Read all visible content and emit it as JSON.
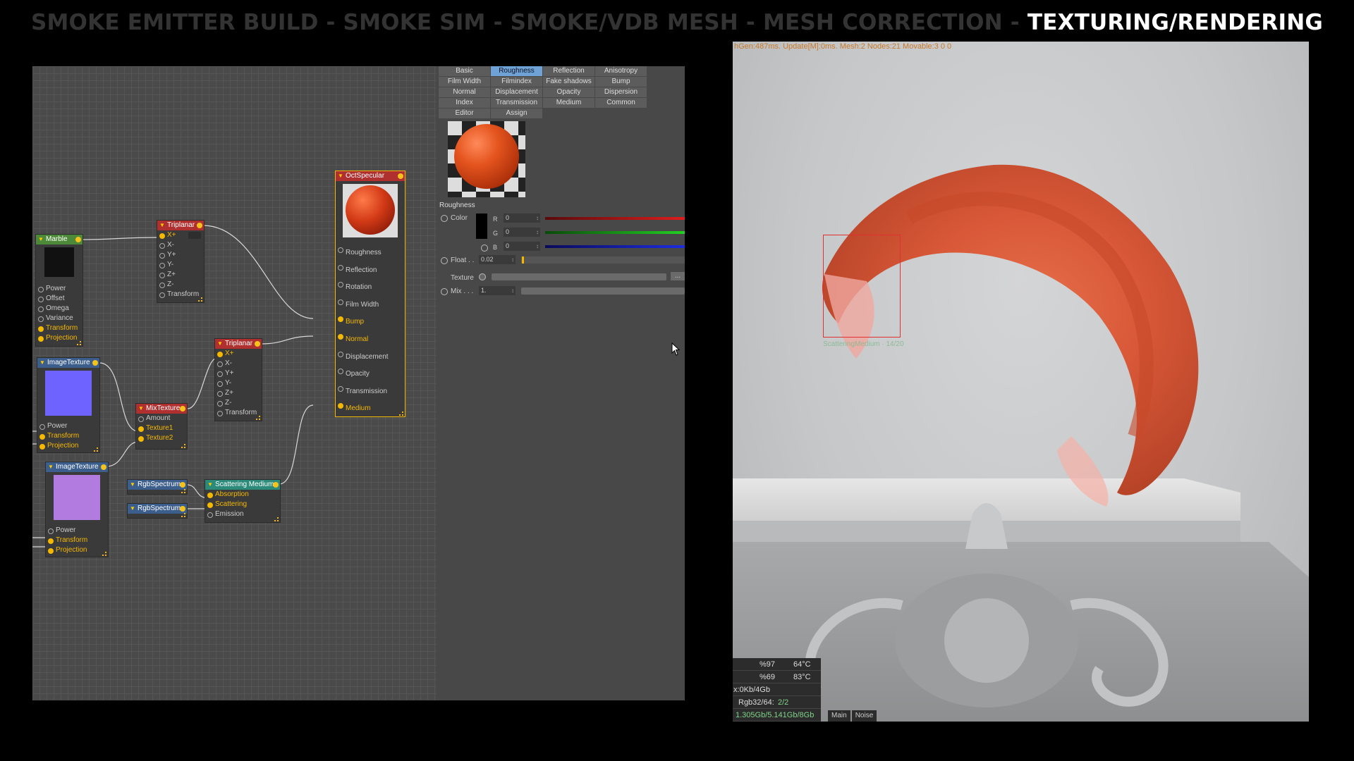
{
  "title": {
    "dim_text": "SMOKE EMITTER BUILD - SMOKE SIM - SMOKE/VDB MESH - MESH CORRECTION - ",
    "active_text": "TEXTURING/RENDERING"
  },
  "nodes": {
    "marble": {
      "title": "Marble",
      "pins": [
        "Power",
        "Offset",
        "Omega",
        "Variance",
        "Transform",
        "Projection"
      ]
    },
    "triplanar_1": {
      "title": "Triplanar",
      "pins": [
        "X+",
        "X-",
        "Y+",
        "Y-",
        "Z+",
        "Z-",
        "Transform"
      ]
    },
    "triplanar_2": {
      "title": "Triplanar",
      "pins": [
        "X+",
        "X-",
        "Y+",
        "Y-",
        "Z+",
        "Z-",
        "Transform"
      ]
    },
    "image_texture_1": {
      "title": "ImageTexture",
      "preview_color": "#6e63ff",
      "pins": [
        "Power",
        "Transform",
        "Projection"
      ]
    },
    "image_texture_2": {
      "title": "ImageTexture",
      "preview_color": "#b17be0",
      "pins": [
        "Power",
        "Transform",
        "Projection"
      ]
    },
    "mix_texture": {
      "title": "MixTexture",
      "pins": [
        "Amount",
        "Texture1",
        "Texture2"
      ]
    },
    "rgb_spectrum_1": {
      "title": "RgbSpectrum"
    },
    "rgb_spectrum_2": {
      "title": "RgbSpectrum"
    },
    "scattering_medium": {
      "title": "Scattering Medium",
      "pins": [
        "Absorption",
        "Scattering",
        "Emission"
      ]
    },
    "oct_specular": {
      "title": "OctSpecular",
      "pins": [
        "Roughness",
        "Reflection",
        "Rotation",
        "Film Width",
        "Bump",
        "Normal",
        "Displacement",
        "Opacity",
        "Transmission",
        "Medium"
      ]
    }
  },
  "material_panel": {
    "tabs": [
      "Basic",
      "Roughness",
      "Reflection",
      "Anisotropy",
      "Film Width",
      "Filmindex",
      "Fake shadows",
      "Bump",
      "Normal",
      "Displacement",
      "Opacity",
      "Dispersion",
      "Index",
      "Transmission",
      "Medium",
      "Common",
      "Editor",
      "Assign"
    ],
    "active_tab": "Roughness",
    "section": "Roughness",
    "color_label": "Color",
    "r_label": "R",
    "g_label": "G",
    "b_label": "B",
    "r_value": "0",
    "g_value": "0",
    "b_value": "0",
    "float_label": "Float . .",
    "float_value": "0.02",
    "texture_label": "Texture",
    "texture_button": "...",
    "mix_label": "Mix . . .",
    "mix_value": "1."
  },
  "viewport": {
    "status_line": "hGen:487ms. Update[M]:0ms. Mesh:2 Nodes:21 Movable:3  0 0",
    "selection_label": "ScatteringMedium · 14/20",
    "hud": {
      "gpu1_load": "%97",
      "gpu1_temp": "64°C",
      "gpu2_load": "%69",
      "gpu2_temp": "83°C",
      "mem": "x:0Kb/4Gb",
      "rgb_label": "Rgb32/64:",
      "rgb_value": "2/2",
      "vram": "1.305Gb/5.141Gb/8Gb"
    },
    "tabs": [
      "Main",
      "Noise"
    ]
  },
  "colors": {
    "accent_yellow": "#f5b800",
    "material_orange": "#e4541e",
    "selection_red": "#e03030"
  }
}
